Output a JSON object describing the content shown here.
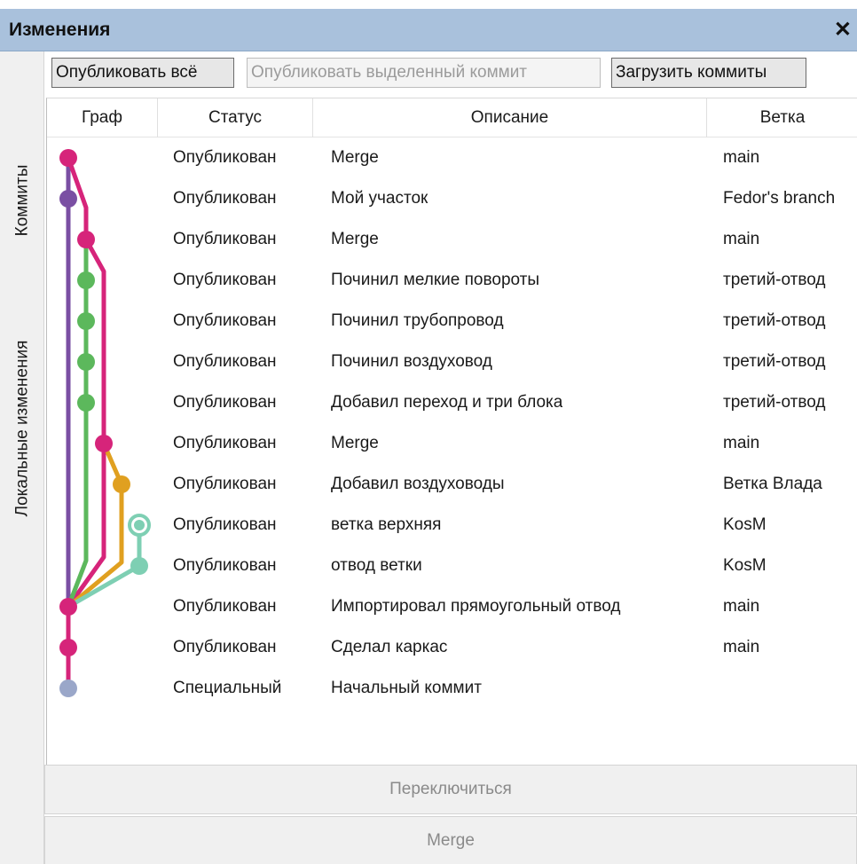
{
  "window": {
    "title": "Изменения",
    "close_glyph": "✕"
  },
  "sidebar": {
    "tabs": [
      "Коммиты",
      "Локальные изменения"
    ]
  },
  "toolbar": {
    "publish_all": "Опубликовать всё",
    "publish_selected": "Опубликовать выделенный коммит",
    "load_commits": "Загрузить коммиты"
  },
  "table": {
    "columns": {
      "graph": "Граф",
      "status": "Статус",
      "description": "Описание",
      "branch": "Ветка"
    },
    "rows": [
      {
        "status": "Опубликован",
        "description": "Merge",
        "branch": "main"
      },
      {
        "status": "Опубликован",
        "description": "Мой участок",
        "branch": "Fedor's branch"
      },
      {
        "status": "Опубликован",
        "description": "Merge",
        "branch": "main"
      },
      {
        "status": "Опубликован",
        "description": "Починил мелкие повороты",
        "branch": "третий-отвод"
      },
      {
        "status": "Опубликован",
        "description": "Починил трубопровод",
        "branch": "третий-отвод"
      },
      {
        "status": "Опубликован",
        "description": "Починил воздуховод",
        "branch": "третий-отвод"
      },
      {
        "status": "Опубликован",
        "description": "Добавил переход и три блока",
        "branch": "третий-отвод"
      },
      {
        "status": "Опубликован",
        "description": "Merge",
        "branch": "main"
      },
      {
        "status": "Опубликован",
        "description": "Добавил воздуховоды",
        "branch": "Ветка Влада"
      },
      {
        "status": "Опубликован",
        "description": "ветка верхняя",
        "branch": "KosM"
      },
      {
        "status": "Опубликован",
        "description": "отвод ветки",
        "branch": "KosM"
      },
      {
        "status": "Опубликован",
        "description": "Импортировал прямоугольный отвод",
        "branch": "main"
      },
      {
        "status": "Опубликован",
        "description": "Сделал каркас",
        "branch": "main"
      },
      {
        "status": "Специальный",
        "description": "Начальный коммит",
        "branch": ""
      }
    ]
  },
  "graph_colors": {
    "main": "#d6247a",
    "fedor": "#7a4fa3",
    "third": "#5cb85c",
    "vlad": "#e0a020",
    "kosm": "#7ecfb3",
    "root": "#9aa7c9"
  },
  "scrollbar": {
    "left_arrow": "<",
    "right_arrow": ">"
  },
  "actions": {
    "switch": "Переключиться",
    "merge": "Merge"
  }
}
